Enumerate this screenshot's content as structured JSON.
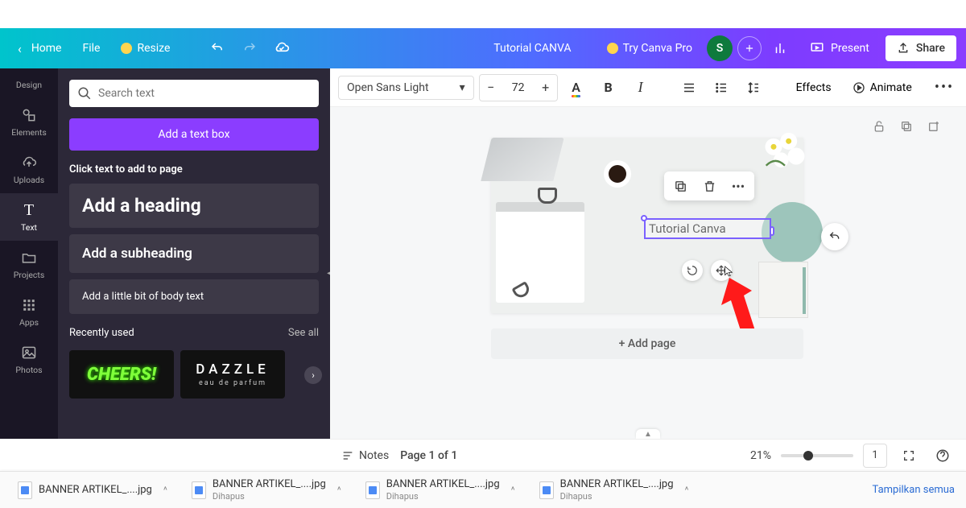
{
  "header": {
    "home": "Home",
    "file": "File",
    "resize": "Resize",
    "document_title": "Tutorial CANVA",
    "try_pro": "Try Canva Pro",
    "avatar_initial": "S",
    "present": "Present",
    "share": "Share"
  },
  "rail": {
    "design": "Design",
    "elements": "Elements",
    "uploads": "Uploads",
    "text": "Text",
    "projects": "Projects",
    "apps": "Apps",
    "photos": "Photos"
  },
  "sidepanel": {
    "search_placeholder": "Search text",
    "add_text_box": "Add a text box",
    "click_hint": "Click text to add to page",
    "add_heading": "Add a heading",
    "add_subheading": "Add a subheading",
    "add_body": "Add a little bit of body text",
    "recently_used": "Recently used",
    "see_all": "See all",
    "thumb1": "CHEERS!",
    "thumb2_title": "DAZZLE",
    "thumb2_sub": "eau de parfum"
  },
  "toolbar": {
    "font_name": "Open Sans Light",
    "font_size": "72",
    "effects": "Effects",
    "animate": "Animate"
  },
  "canvas": {
    "selected_text": "Tutorial Canva",
    "add_page": "+ Add page"
  },
  "footer": {
    "notes": "Notes",
    "page_indicator": "Page 1 of 1",
    "zoom": "21%",
    "page_count": "1"
  },
  "downloads": {
    "items": [
      {
        "name": "BANNER ARTIKEL_....jpg",
        "status": ""
      },
      {
        "name": "BANNER ARTIKEL_....jpg",
        "status": "Dihapus"
      },
      {
        "name": "BANNER ARTIKEL_....jpg",
        "status": "Dihapus"
      },
      {
        "name": "BANNER ARTIKEL_....jpg",
        "status": "Dihapus"
      }
    ],
    "show_all": "Tampilkan semua"
  }
}
